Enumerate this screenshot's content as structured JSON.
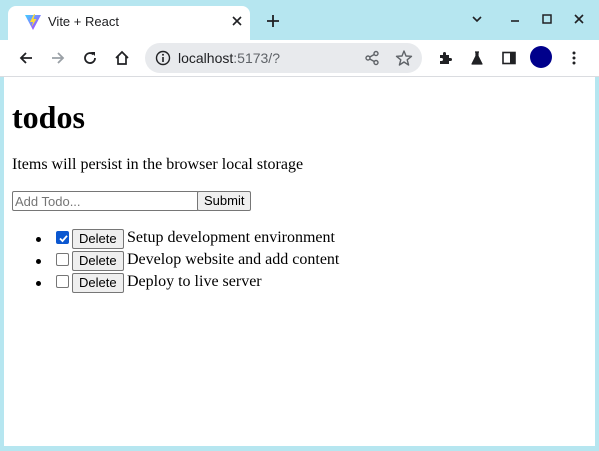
{
  "browser": {
    "tab_title": "Vite + React",
    "url_host": "localhost",
    "url_rest": ":5173/?"
  },
  "page": {
    "heading": "todos",
    "subtitle": "Items will persist in the browser local storage",
    "input_placeholder": "Add Todo...",
    "submit_label": "Submit",
    "delete_label": "Delete",
    "todos": [
      {
        "text": "Setup development environment",
        "done": true
      },
      {
        "text": "Develop website and add content",
        "done": false
      },
      {
        "text": "Deploy to live server",
        "done": false
      }
    ]
  },
  "colors": {
    "frame": "#b6e6f0",
    "profile": "#00008b",
    "checkbox_checked": "#0b57d0"
  }
}
